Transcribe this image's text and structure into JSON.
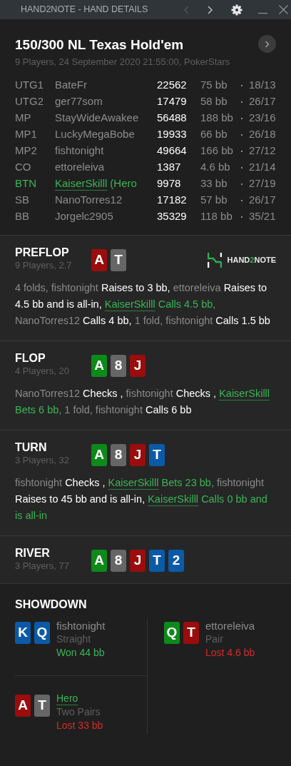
{
  "window": {
    "title": "HAND2NOTE - HAND DETAILS",
    "prev_disabled": true
  },
  "hand": {
    "title": "150/300 NL Texas Hold'em",
    "subtitle": "9 Players, 24 September 2020 21:55:00, PokerStars"
  },
  "players": [
    {
      "position": "UTG1",
      "name": "BateFr",
      "stack": "22562",
      "bb": "75 bb",
      "stat": "18/13",
      "hero": false
    },
    {
      "position": "UTG2",
      "name": "ger77som",
      "stack": "17479",
      "bb": "58 bb",
      "stat": "26/17",
      "hero": false
    },
    {
      "position": "MP",
      "name": "StayWideAwakee",
      "stack": "56488",
      "bb": "188 bb",
      "stat": "23/16",
      "hero": false
    },
    {
      "position": "MP1",
      "name": "LuckyMegaBobe",
      "stack": "19933",
      "bb": "66 bb",
      "stat": "26/18",
      "hero": false
    },
    {
      "position": "MP2",
      "name": "fishtonight",
      "stack": "49664",
      "bb": "166 bb",
      "stat": "27/12",
      "hero": false
    },
    {
      "position": "CO",
      "name": "ettoreleiva",
      "stack": "1387",
      "bb": "4.6 bb",
      "stat": "21/14",
      "hero": false
    },
    {
      "position": "BTN",
      "name": "KaiserSkilll",
      "suffix": "(Hero",
      "stack": "9978",
      "bb": "33 bb",
      "stat": "27/19",
      "hero": true
    },
    {
      "position": "SB",
      "name": "NanoTorres12",
      "stack": "17182",
      "bb": "57 bb",
      "stat": "26/17",
      "hero": false
    },
    {
      "position": "BB",
      "name": "Jorgelc2905",
      "stack": "35329",
      "bb": "118 bb",
      "stat": "35/21",
      "hero": false
    }
  ],
  "logo": {
    "parts": [
      {
        "text": "HAND",
        "accent": false
      },
      {
        "text": "2",
        "accent": true
      },
      {
        "text": "NOTE",
        "accent": false
      }
    ]
  },
  "streets": [
    {
      "name": "PREFLOP",
      "info": "9 Players, 2.7",
      "logo": true,
      "cards": [
        {
          "rank": "A",
          "color": "#9b0c0c"
        },
        {
          "rank": "T",
          "color": "#666666"
        }
      ],
      "actions": [
        {
          "kind": "player",
          "text": "4 folds, fishtonight"
        },
        {
          "kind": "action",
          "text": "Raises to 3 bb,"
        },
        {
          "kind": "player",
          "text": "ettoreleiva"
        },
        {
          "kind": "action",
          "text": "Raises to 4.5 bb and is all-in,"
        },
        {
          "kind": "hero",
          "text": "KaiserSkilll"
        },
        {
          "kind": "hero_action",
          "text": "Calls 4.5 bb,"
        },
        {
          "kind": "player",
          "text": "NanoTorres12"
        },
        {
          "kind": "action",
          "text": "Calls 4 bb,"
        },
        {
          "kind": "player",
          "text": "1 fold, fishtonight"
        },
        {
          "kind": "action",
          "text": "Calls 1.5 bb"
        }
      ]
    },
    {
      "name": "FLOP",
      "info": "4 Players, 20",
      "logo": false,
      "cards": [
        {
          "rank": "A",
          "color": "#0c8a1a"
        },
        {
          "rank": "8",
          "color": "#666666"
        },
        {
          "rank": "J",
          "color": "#9b0c0c"
        }
      ],
      "actions": [
        {
          "kind": "player",
          "text": "NanoTorres12"
        },
        {
          "kind": "action",
          "text": "Checks ,"
        },
        {
          "kind": "player",
          "text": "fishtonight"
        },
        {
          "kind": "action",
          "text": "Checks ,"
        },
        {
          "kind": "hero",
          "text": "KaiserSkilll"
        },
        {
          "kind": "hero_action",
          "text": "Bets 6 bb,"
        },
        {
          "kind": "player",
          "text": "1 fold, fishtonight"
        },
        {
          "kind": "action",
          "text": "Calls 6 bb"
        }
      ]
    },
    {
      "name": "TURN",
      "info": "3 Players, 32",
      "logo": false,
      "cards": [
        {
          "rank": "A",
          "color": "#0c8a1a"
        },
        {
          "rank": "8",
          "color": "#666666"
        },
        {
          "rank": "J",
          "color": "#9b0c0c"
        },
        {
          "rank": "T",
          "color": "#0b5aa8"
        }
      ],
      "actions": [
        {
          "kind": "player",
          "text": "fishtonight"
        },
        {
          "kind": "action",
          "text": "Checks ,"
        },
        {
          "kind": "hero",
          "text": "KaiserSkilll"
        },
        {
          "kind": "hero_action",
          "text": "Bets 23 bb,"
        },
        {
          "kind": "player",
          "text": "fishtonight"
        },
        {
          "kind": "action",
          "text": "Raises to 45 bb and is all-in,"
        },
        {
          "kind": "hero",
          "text": "KaiserSkilll"
        },
        {
          "kind": "hero_action",
          "text": "Calls 0 bb and is all-in"
        }
      ]
    },
    {
      "name": "RIVER",
      "info": "3 Players, 77",
      "logo": false,
      "cards": [
        {
          "rank": "A",
          "color": "#0c8a1a"
        },
        {
          "rank": "8",
          "color": "#666666"
        },
        {
          "rank": "J",
          "color": "#9b0c0c"
        },
        {
          "rank": "T",
          "color": "#0b5aa8"
        },
        {
          "rank": "2",
          "color": "#0b5aa8"
        }
      ]
    }
  ],
  "showdown": {
    "title": "SHOWDOWN",
    "hands": [
      {
        "name": "fishtonight",
        "hero": false,
        "hand": "Straight",
        "result": "Won 44 bb",
        "won": true,
        "cards": [
          {
            "rank": "K",
            "color": "#0b5aa8"
          },
          {
            "rank": "Q",
            "color": "#0b5aa8"
          }
        ]
      },
      {
        "name": "ettoreleiva",
        "hero": false,
        "hand": "Pair",
        "result": "Lost 4.6 bb",
        "won": false,
        "cards": [
          {
            "rank": "Q",
            "color": "#0c8a1a"
          },
          {
            "rank": "T",
            "color": "#9b0c0c"
          }
        ]
      },
      {
        "name": "Hero",
        "hero": true,
        "hand": "Two Pairs",
        "result": "Lost 33 bb",
        "won": false,
        "cards": [
          {
            "rank": "A",
            "color": "#9b0c0c"
          },
          {
            "rank": "T",
            "color": "#666666"
          }
        ]
      }
    ]
  }
}
